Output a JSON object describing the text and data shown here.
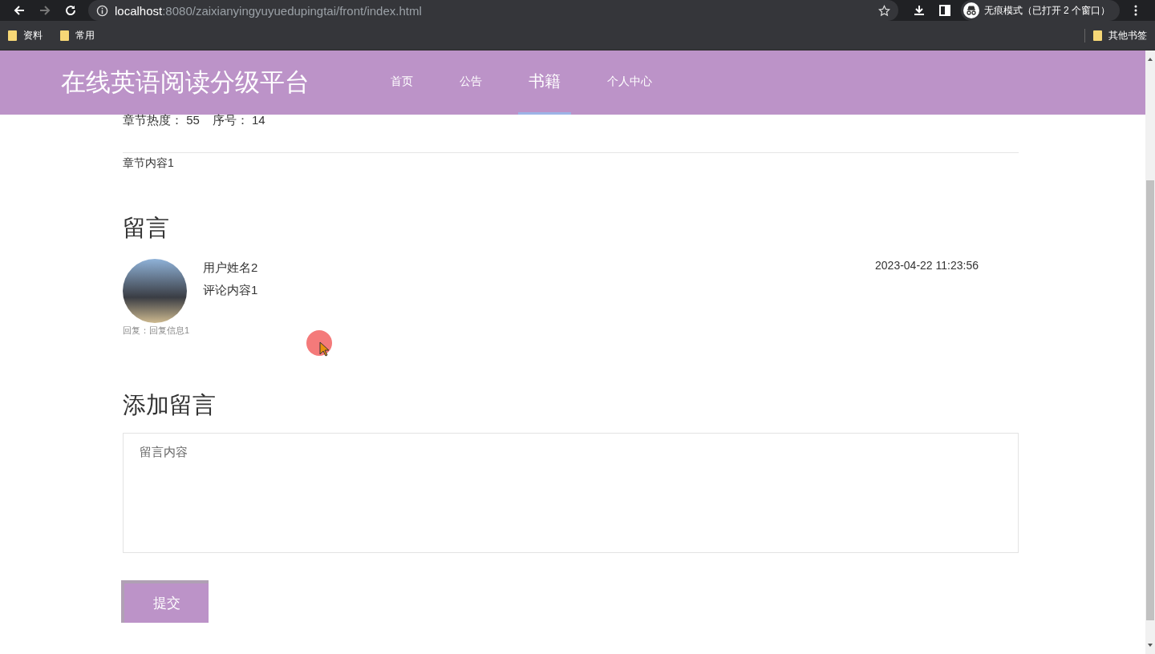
{
  "browser": {
    "url_host": "localhost",
    "url_path": ":8080/zaixianyingyuyuedupingtai/front/index.html",
    "incognito_label": "无痕模式（已打开 2 个窗口）",
    "bookmarks": [
      "资料",
      "常用"
    ],
    "other_bookmarks": "其他书签"
  },
  "header": {
    "site_title": "在线英语阅读分级平台",
    "nav": [
      {
        "label": "首页",
        "selected": false
      },
      {
        "label": "公告",
        "selected": false
      },
      {
        "label": "书籍",
        "selected": true
      },
      {
        "label": "个人中心",
        "selected": false
      }
    ]
  },
  "chapter": {
    "meta": [
      {
        "label": "章节热度：",
        "value": "55"
      },
      {
        "label": "序号：",
        "value": "14"
      }
    ],
    "content": "章节内容1"
  },
  "comments": {
    "heading": "留言",
    "items": [
      {
        "user": "用户姓名2",
        "text": "评论内容1",
        "time": "2023-04-22 11:23:56",
        "reply": "回复：回复信息1"
      }
    ]
  },
  "add_comment": {
    "heading": "添加留言",
    "placeholder": "留言内容",
    "submit": "提交"
  }
}
